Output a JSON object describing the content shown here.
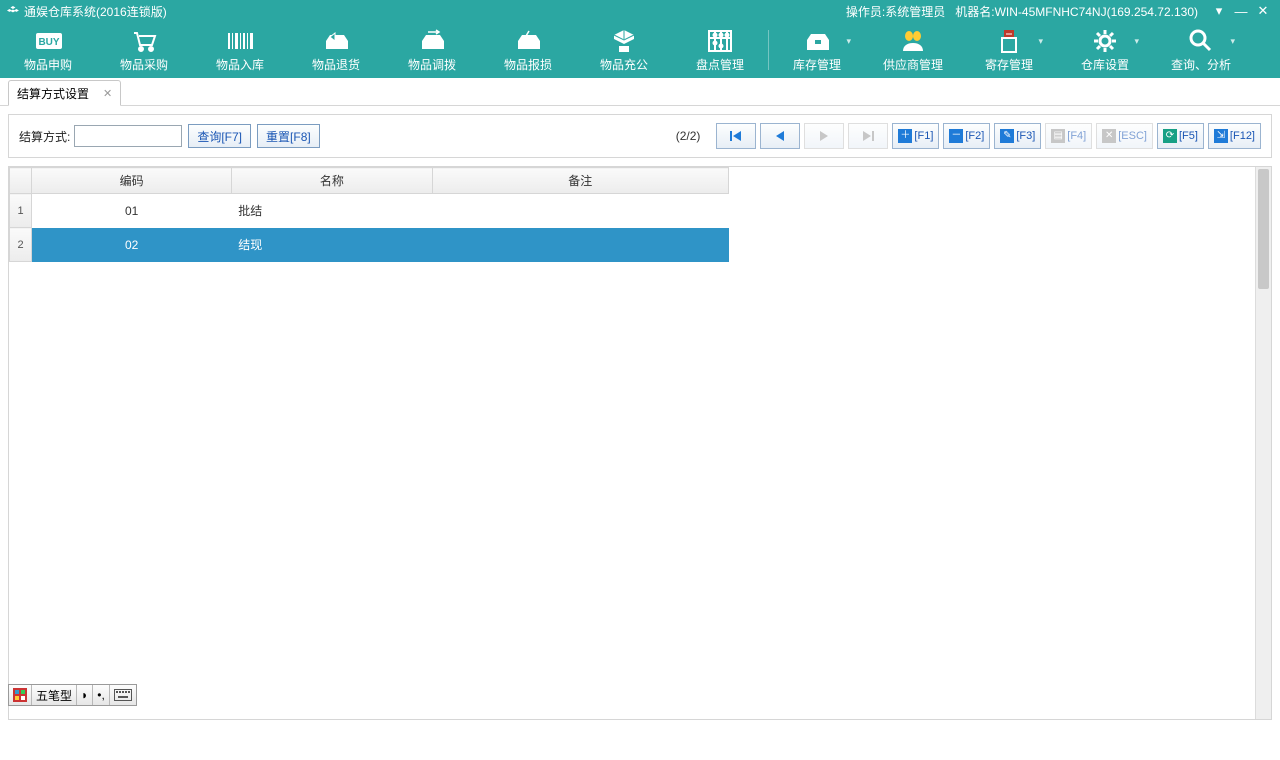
{
  "titlebar": {
    "app_title": "通娱仓库系统(2016连锁版)",
    "operator_label": "操作员:",
    "operator_value": "系统管理员",
    "machine_label": "机器名:",
    "machine_value": "WIN-45MFNHC74NJ(169.254.72.130)"
  },
  "toolbar": {
    "items": [
      {
        "label": "物品申购",
        "icon": "buy-icon",
        "dropdown": false
      },
      {
        "label": "物品采购",
        "icon": "cart-icon",
        "dropdown": false
      },
      {
        "label": "物品入库",
        "icon": "barcode-icon",
        "dropdown": false
      },
      {
        "label": "物品退货",
        "icon": "return-box-icon",
        "dropdown": false
      },
      {
        "label": "物品调拨",
        "icon": "transfer-box-icon",
        "dropdown": false
      },
      {
        "label": "物品报损",
        "icon": "damage-box-icon",
        "dropdown": false
      },
      {
        "label": "物品充公",
        "icon": "confiscate-box-icon",
        "dropdown": false
      },
      {
        "label": "盘点管理",
        "icon": "abacus-icon",
        "dropdown": false
      },
      {
        "label": "库存管理",
        "icon": "stock-box-icon",
        "dropdown": true
      },
      {
        "label": "供应商管理",
        "icon": "supplier-icon",
        "dropdown": false
      },
      {
        "label": "寄存管理",
        "icon": "deposit-icon",
        "dropdown": true
      },
      {
        "label": "仓库设置",
        "icon": "settings-gear-icon",
        "dropdown": true
      },
      {
        "label": "查询、分析",
        "icon": "search-analytics-icon",
        "dropdown": true
      }
    ],
    "separator_after_index": 7
  },
  "tab": {
    "title": "结算方式设置"
  },
  "filter": {
    "label": "结算方式:",
    "value": "",
    "query_btn": "查询[F7]",
    "reset_btn": "重置[F8]",
    "counter": "(2/2)"
  },
  "actions": {
    "f1": "[F1]",
    "f2": "[F2]",
    "f3": "[F3]",
    "f4": "[F4]",
    "esc": "[ESC]",
    "f5": "[F5]",
    "f12": "[F12]"
  },
  "grid": {
    "columns": [
      "编码",
      "名称",
      "备注"
    ],
    "rows": [
      {
        "n": "1",
        "code": "01",
        "name": "批结",
        "remark": "",
        "selected": false
      },
      {
        "n": "2",
        "code": "02",
        "name": "结现",
        "remark": "",
        "selected": true
      }
    ]
  },
  "ime": {
    "label": "五笔型"
  }
}
